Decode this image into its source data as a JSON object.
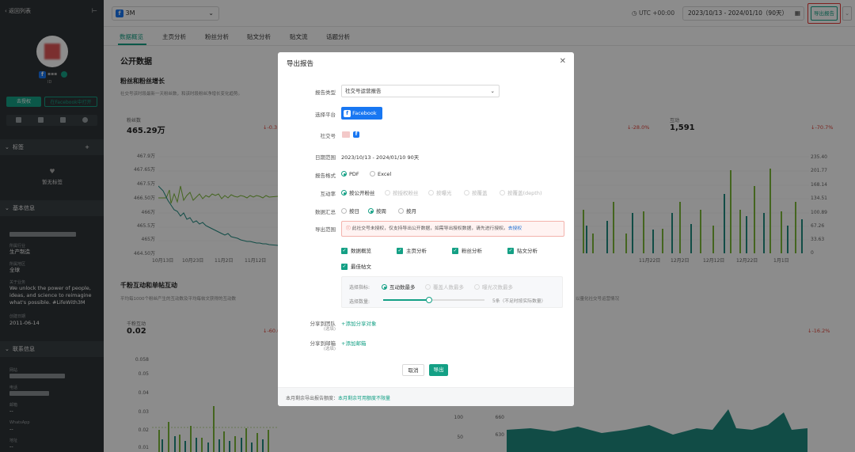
{
  "sidebar": {
    "back_label": "返回列表",
    "collapse_icon": "⊢",
    "account_suffix": "▪▪▪",
    "authorize_label": "去授权",
    "open_fb_label": "在Facebook中打开",
    "tag_section": "标签",
    "no_tag": "暂无标签",
    "basic_section": "基本信息",
    "industry_label": "所属行业",
    "industry_value": "生产制造",
    "region_label": "所属地区",
    "region_value": "全球",
    "about_label": "关于业务",
    "about_value": "We unlock the power of people, ideas, and science to reimagine what's possible. #LifeWith3M",
    "founded_label": "创建日期",
    "founded_value": "2011-06-14",
    "contact_section": "联系信息",
    "website_label": "网站",
    "phone_label": "电话",
    "email_label": "邮箱",
    "email_value": "--",
    "whatsapp_label": "WhatsApp",
    "whatsapp_value": "--",
    "address_label": "地址",
    "address_value": "--"
  },
  "topbar": {
    "account_name": "3M",
    "timezone": "UTC +00:00",
    "date_range": "2023/10/13 - 2024/01/10（90天）",
    "export_label": "导出报告"
  },
  "tabs": [
    "数据概览",
    "主页分析",
    "粉丝分析",
    "贴文分析",
    "贴文流",
    "话题分析"
  ],
  "main": {
    "public_data": "公开数据",
    "fans_section": "粉丝和粉丝增长",
    "fans_desc": "社交号该时段最新一天粉丝数，和该时段粉丝净增长变化趋势。",
    "fans_label": "粉丝数",
    "fans_value": "465.29万",
    "fans_change": "↓-0.3",
    "mid_change": "↓-28.0%",
    "interaction_label": "互动",
    "interaction_value": "1,591",
    "interaction_change": "↓-70.7%",
    "y_left": [
      "467.9万",
      "467.65万",
      "467.5万",
      "467万",
      "466.50万",
      "466万",
      "465.5万",
      "465万",
      "464.50万"
    ],
    "x_left": [
      "10月13日",
      "10月23日",
      "11月2日",
      "11月12日"
    ],
    "y_right": [
      "235.40",
      "201.77",
      "168.14",
      "134.51",
      "100.89",
      "67.26",
      "33.63",
      "0"
    ],
    "x_right": [
      "11月22日",
      "12月2日",
      "12月12日",
      "12月22日",
      "1月1日"
    ],
    "kpi_section": "千粉互动和单帖互动",
    "kpi_desc": "平均每1000个粉丝产生的互动数及平均每帖文获得的互动数",
    "kpi_desc_right": "以量化社交号运营情况",
    "kpi_label": "千粉互动",
    "kpi_value": "0.02",
    "kpi_change": "↓-60.0",
    "kpi_change_right": "↓-16.2%",
    "y_bottom": [
      "0.058",
      "0.05",
      "0.04",
      "0.03",
      "0.02",
      "0.01"
    ],
    "y_bottom_right_a": [
      "100",
      "50"
    ],
    "y_bottom_right_b": [
      "660",
      "630"
    ]
  },
  "modal": {
    "title": "导出报告",
    "report_type_label": "报告类型",
    "report_type_value": "社交号运营报告",
    "platform_label": "选择平台",
    "platform_value": "Facebook",
    "account_label": "社交号",
    "date_label": "日期范围",
    "date_value": "2023/10/13 - 2024/01/10 90天",
    "format_label": "报告格式",
    "format_options": [
      "PDF",
      "Excel"
    ],
    "rate_label": "互动率",
    "rate_options": [
      "按公开粉丝",
      "按授权粉丝",
      "按曝光",
      "按覆盖",
      "按覆盖(depth)"
    ],
    "summary_label": "数据汇总",
    "summary_options": [
      "按日",
      "按周",
      "按月"
    ],
    "scope_label": "导出范围",
    "warning": "此社交号未授权，仅支持导出公开数据，如需导出授权数据，请先进行授权。",
    "warning_link": "去授权",
    "checks": [
      "数据概览",
      "主页分析",
      "粉丝分析",
      "贴文分析",
      "最佳帖文"
    ],
    "metric_label": "选择指标:",
    "metric_options": [
      "互动数最多",
      "覆盖人数最多",
      "曝光次数最多"
    ],
    "count_label": "选择数量:",
    "count_value": "5条（不足时按实际数量）",
    "team_label": "分享到团队",
    "team_optional": "(选填)",
    "team_link": "+添加分享对象",
    "mail_label": "分享到邮箱",
    "mail_optional": "(选填)",
    "mail_link": "+添加邮箱",
    "cancel": "取消",
    "export": "导出",
    "footer_prefix": "本月剩余导出报告额度：",
    "footer_link": "本月剩余可用额度不限量"
  },
  "colors": {
    "accent": "#14a085",
    "warn": "#e0443a",
    "chart_green": "#7db83a",
    "chart_teal": "#1f8a80"
  }
}
